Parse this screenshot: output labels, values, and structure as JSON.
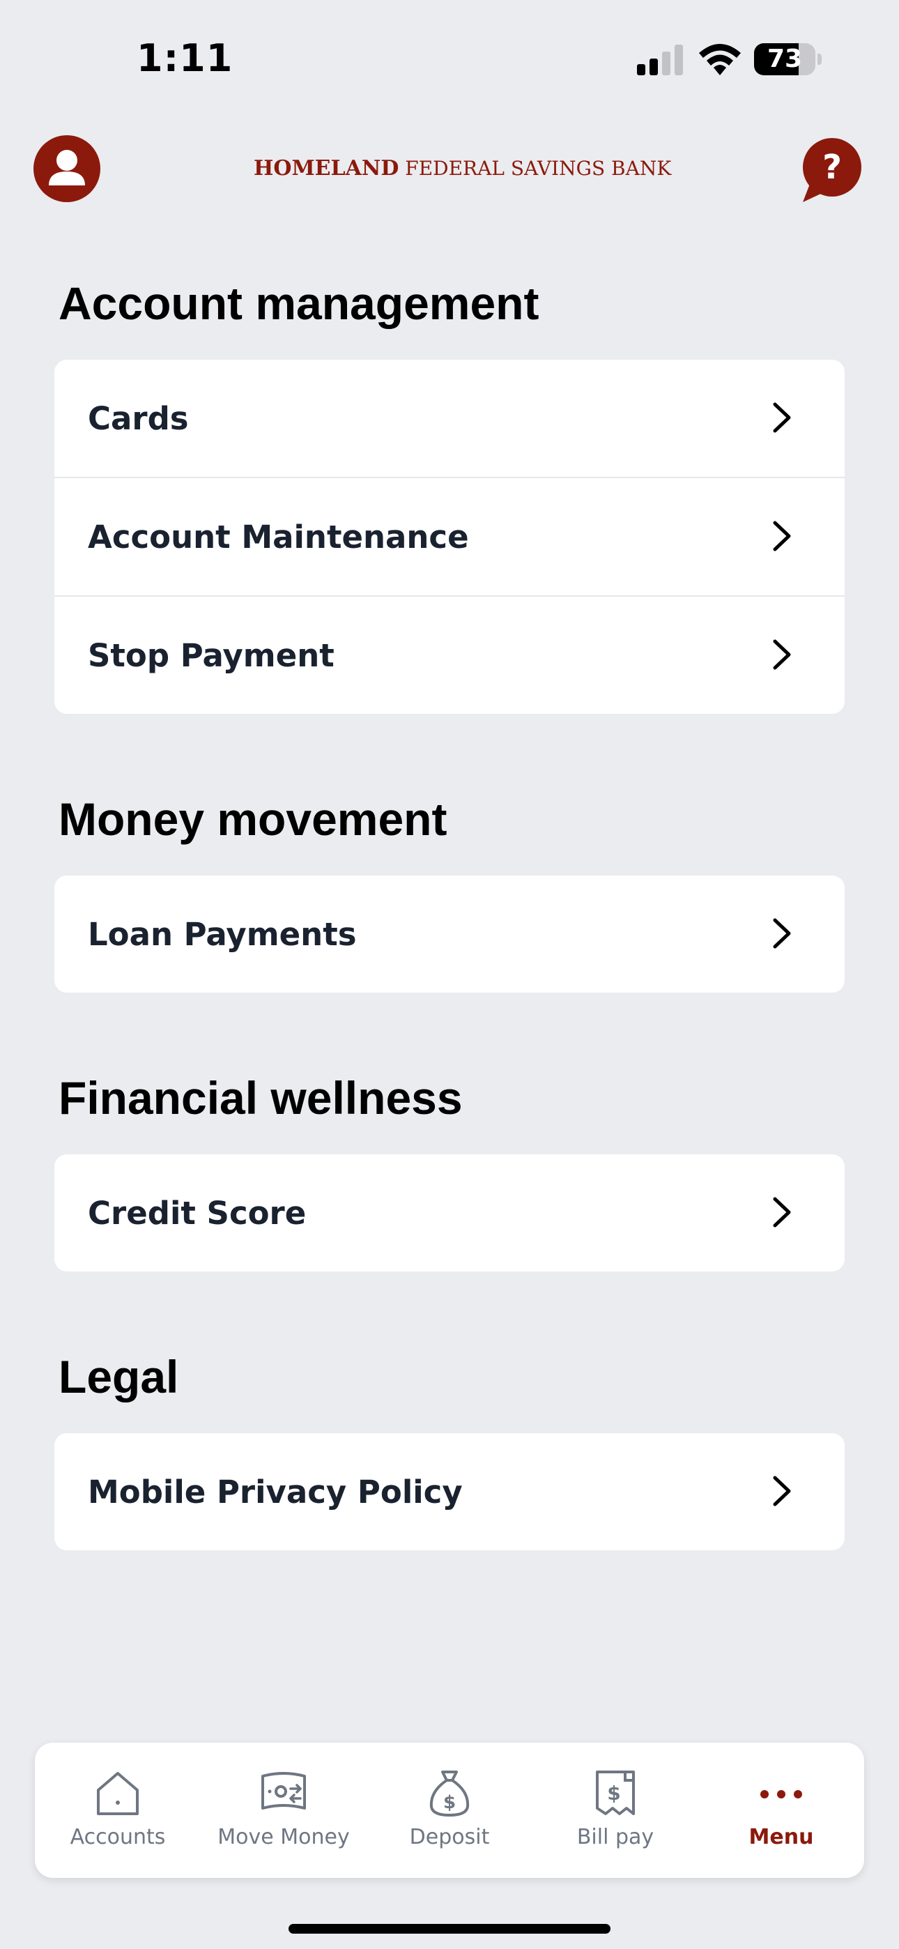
{
  "status_bar": {
    "time": "1:11",
    "battery": "73"
  },
  "header": {
    "brand_strong": "HOMELAND",
    "brand_light": " FEDERAL SAVINGS BANK",
    "profile_icon": "user-icon",
    "help_icon": "help-chat-icon"
  },
  "colors": {
    "brand": "#8b1a0c",
    "background": "#ebecf0",
    "card": "#ffffff",
    "text": "#1a2230",
    "muted": "#6e7682"
  },
  "sections": [
    {
      "title": "Account management",
      "items": [
        "Cards",
        "Account Maintenance",
        "Stop Payment"
      ]
    },
    {
      "title": "Money movement",
      "items": [
        "Loan Payments"
      ]
    },
    {
      "title": "Financial wellness",
      "items": [
        "Credit Score"
      ]
    },
    {
      "title": "Legal",
      "items": [
        "Mobile Privacy Policy"
      ]
    }
  ],
  "bottom_nav": [
    {
      "label": "Accounts",
      "icon": "house-icon"
    },
    {
      "label": "Move Money",
      "icon": "money-transfer-icon"
    },
    {
      "label": "Deposit",
      "icon": "money-bag-icon"
    },
    {
      "label": "Bill pay",
      "icon": "receipt-dollar-icon"
    },
    {
      "label": "Menu",
      "icon": "more-dots-icon",
      "active": true
    }
  ]
}
